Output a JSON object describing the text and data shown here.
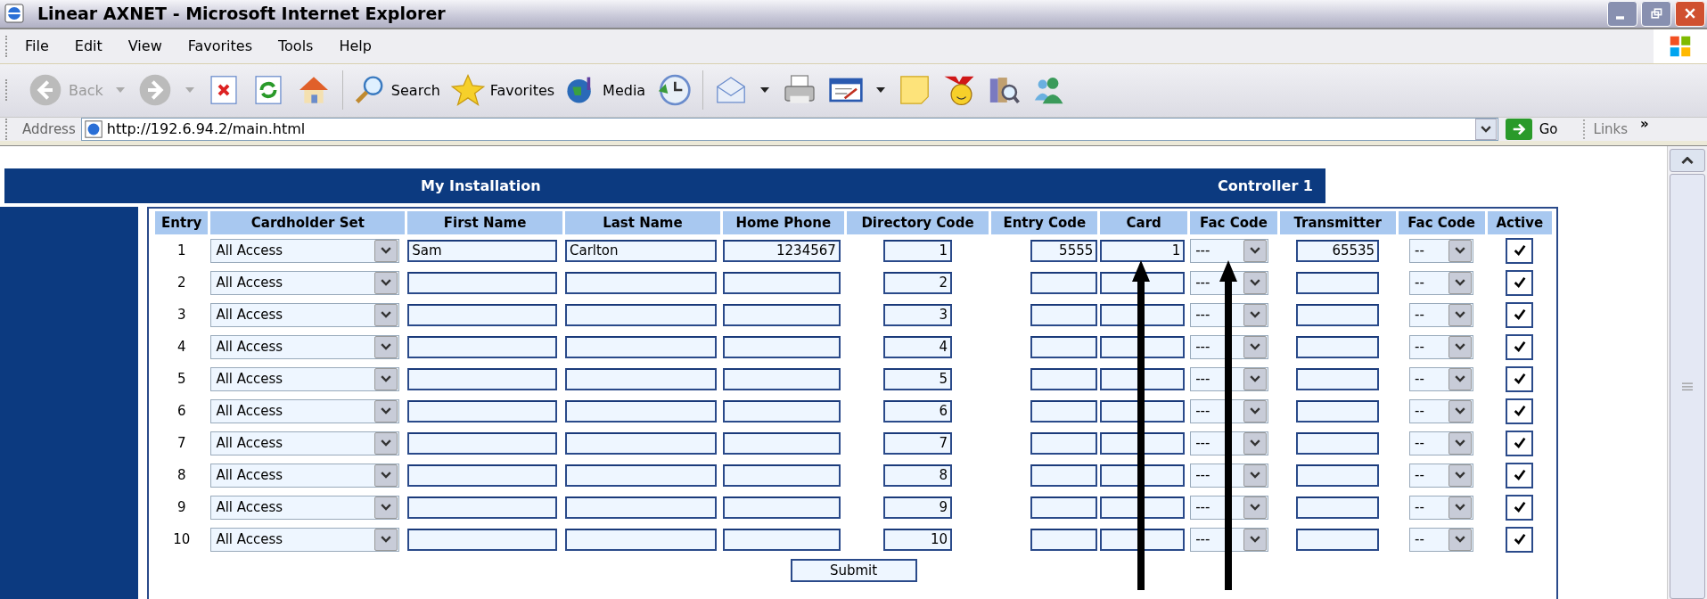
{
  "window": {
    "title": "Linear AXNET - Microsoft Internet Explorer"
  },
  "menu": [
    "File",
    "Edit",
    "View",
    "Favorites",
    "Tools",
    "Help"
  ],
  "toolbar": {
    "back": {
      "label": "Back",
      "disabled": true
    },
    "search": "Search",
    "favorites": "Favorites",
    "media": "Media"
  },
  "address_bar": {
    "label": "Address",
    "url": "http://192.6.94.2/main.html",
    "go": "Go",
    "links": "Links",
    "more": "»"
  },
  "page": {
    "title": "My Installation",
    "controller": "Controller 1"
  },
  "table": {
    "columns": [
      "Entry",
      "Cardholder Set",
      "First Name",
      "Last Name",
      "Home Phone",
      "Directory Code",
      "Entry Code",
      "Card",
      "Fac Code",
      "Transmitter",
      "Fac Code",
      "Active"
    ],
    "rows": [
      {
        "entry": "1",
        "cardholder_set": "All Access",
        "first_name": "Sam",
        "last_name": "Carlton",
        "home_phone": "1234567",
        "directory_code": "1",
        "entry_code": "5555",
        "card": "1",
        "fac_code": "---",
        "transmitter": "65535",
        "fac_code_2": "--",
        "active": true
      },
      {
        "entry": "2",
        "cardholder_set": "All Access",
        "directory_code": "2",
        "fac_code": "---",
        "fac_code_2": "--",
        "active": true
      },
      {
        "entry": "3",
        "cardholder_set": "All Access",
        "directory_code": "3",
        "fac_code": "---",
        "fac_code_2": "--",
        "active": true
      },
      {
        "entry": "4",
        "cardholder_set": "All Access",
        "directory_code": "4",
        "fac_code": "---",
        "fac_code_2": "--",
        "active": true
      },
      {
        "entry": "5",
        "cardholder_set": "All Access",
        "directory_code": "5",
        "fac_code": "---",
        "fac_code_2": "--",
        "active": true
      },
      {
        "entry": "6",
        "cardholder_set": "All Access",
        "directory_code": "6",
        "fac_code": "---",
        "fac_code_2": "--",
        "active": true
      },
      {
        "entry": "7",
        "cardholder_set": "All Access",
        "directory_code": "7",
        "fac_code": "---",
        "fac_code_2": "--",
        "active": true
      },
      {
        "entry": "8",
        "cardholder_set": "All Access",
        "directory_code": "8",
        "fac_code": "---",
        "fac_code_2": "--",
        "active": true
      },
      {
        "entry": "9",
        "cardholder_set": "All Access",
        "directory_code": "9",
        "fac_code": "---",
        "fac_code_2": "--",
        "active": true
      },
      {
        "entry": "10",
        "cardholder_set": "All Access",
        "directory_code": "10",
        "fac_code": "---",
        "fac_code_2": "--",
        "active": true
      }
    ],
    "submit": "Submit"
  }
}
